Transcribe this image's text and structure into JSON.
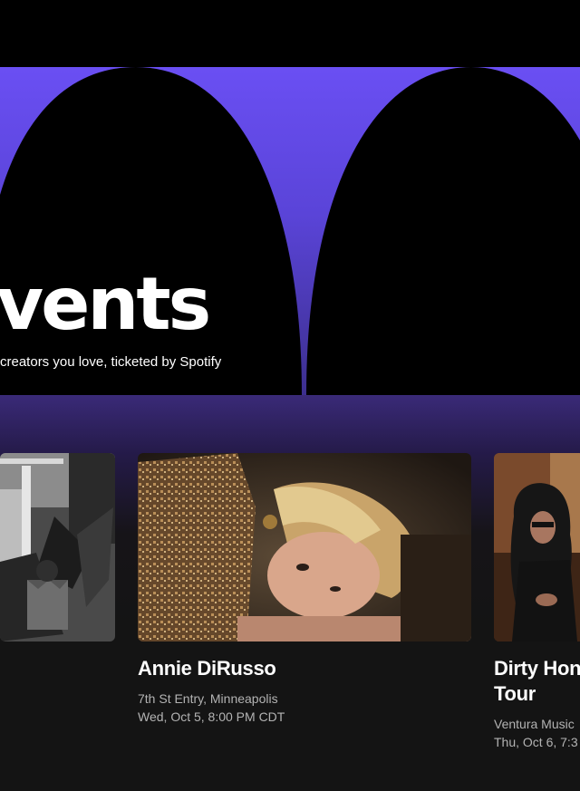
{
  "hero": {
    "title": "vents",
    "subtitle": "creators you love, ticketed by Spotify"
  },
  "colors": {
    "hero_purple": "#6a4ff3",
    "background": "#141414",
    "meta_text": "#b3b3b3"
  },
  "events": [
    {
      "title": "",
      "venue": "",
      "datetime": "",
      "image": "bw-porch-photo"
    },
    {
      "title": "Annie DiRusso",
      "venue": "7th St Entry, Minneapolis",
      "datetime": "Wed, Oct 5, 8:00 PM CDT",
      "image": "woman-lying-on-arm-photo"
    },
    {
      "title": "Dirty Hon",
      "title_line2": "Tour",
      "venue": "Ventura Music",
      "datetime": "Thu, Oct 6, 7:3",
      "image": "long-haired-man-photo"
    }
  ]
}
